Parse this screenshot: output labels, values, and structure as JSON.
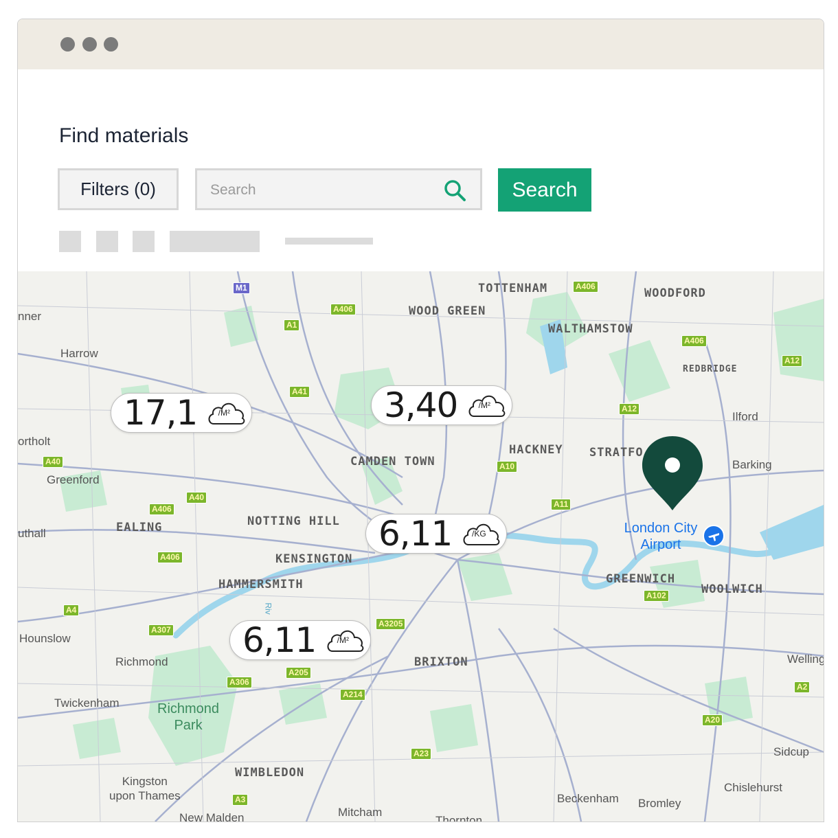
{
  "page": {
    "title": "Find materials"
  },
  "toolbar": {
    "filters_label": "Filters (0)",
    "search_placeholder": "Search",
    "search_button_label": "Search"
  },
  "colors": {
    "accent": "#14a275",
    "pin": "#134a3c",
    "water": "#9fd6ec",
    "park": "#c8ebd3"
  },
  "map": {
    "labels": {
      "tottenham": "TOTTENHAM",
      "woodford": "WOODFORD",
      "wood_green": "WOOD GREEN",
      "walthamstow": "WALTHAMSTOW",
      "redbridge": "REDBRIDGE",
      "harrow": "Harrow",
      "pinner": "nner",
      "northolt": "ortholt",
      "ilford": "Ilford",
      "hackney": "HACKNEY",
      "stratford": "STRATFO",
      "camden_town": "CAMDEN TOWN",
      "barking": "Barking",
      "greenford": "Greenford",
      "notting_hill": "NOTTING HILL",
      "ealing": "EALING",
      "southall": "uthall",
      "kensington": "KENSINGTON",
      "hammersmith": "HAMMERSMITH",
      "greenwich": "GREENWICH",
      "woolwich": "WOOLWICH",
      "hounslow": "Hounslow",
      "richmond": "Richmond",
      "brixton": "BRIXTON",
      "welling": "Welling",
      "twickenham": "Twickenham",
      "richmond_park": "Richmond\nPark",
      "wimbledon": "WIMBLEDON",
      "kingston": "Kingston\nupon Thames",
      "sidcup": "Sidcup",
      "chislehurst": "Chislehurst",
      "beckenham": "Beckenham",
      "bromley": "Bromley",
      "mitcham": "Mitcham",
      "new_malden": "New Malden",
      "thornton": "Thornton",
      "river": "Riv",
      "airport": "London\nCity Airport"
    },
    "roads": [
      "M1",
      "A406",
      "A406",
      "A1",
      "A406",
      "A12",
      "A41",
      "A12",
      "A40",
      "A10",
      "A40",
      "A406",
      "A11",
      "A406",
      "A102",
      "A4",
      "A307",
      "A3205",
      "A205",
      "A306",
      "A214",
      "A2",
      "A20",
      "A23",
      "A3"
    ],
    "badges": [
      {
        "value": "17,1",
        "unit": "/M²",
        "icon": "cloud-icon"
      },
      {
        "value": "3,40",
        "unit": "/M²",
        "icon": "cloud-icon"
      },
      {
        "value": "6,11",
        "unit": "/KG",
        "icon": "cloud-icon"
      },
      {
        "value": "6,11",
        "unit": "/M²",
        "icon": "cloud-icon"
      }
    ],
    "pin_icon": "map-pin-icon",
    "airport_icon": "airplane-icon"
  }
}
